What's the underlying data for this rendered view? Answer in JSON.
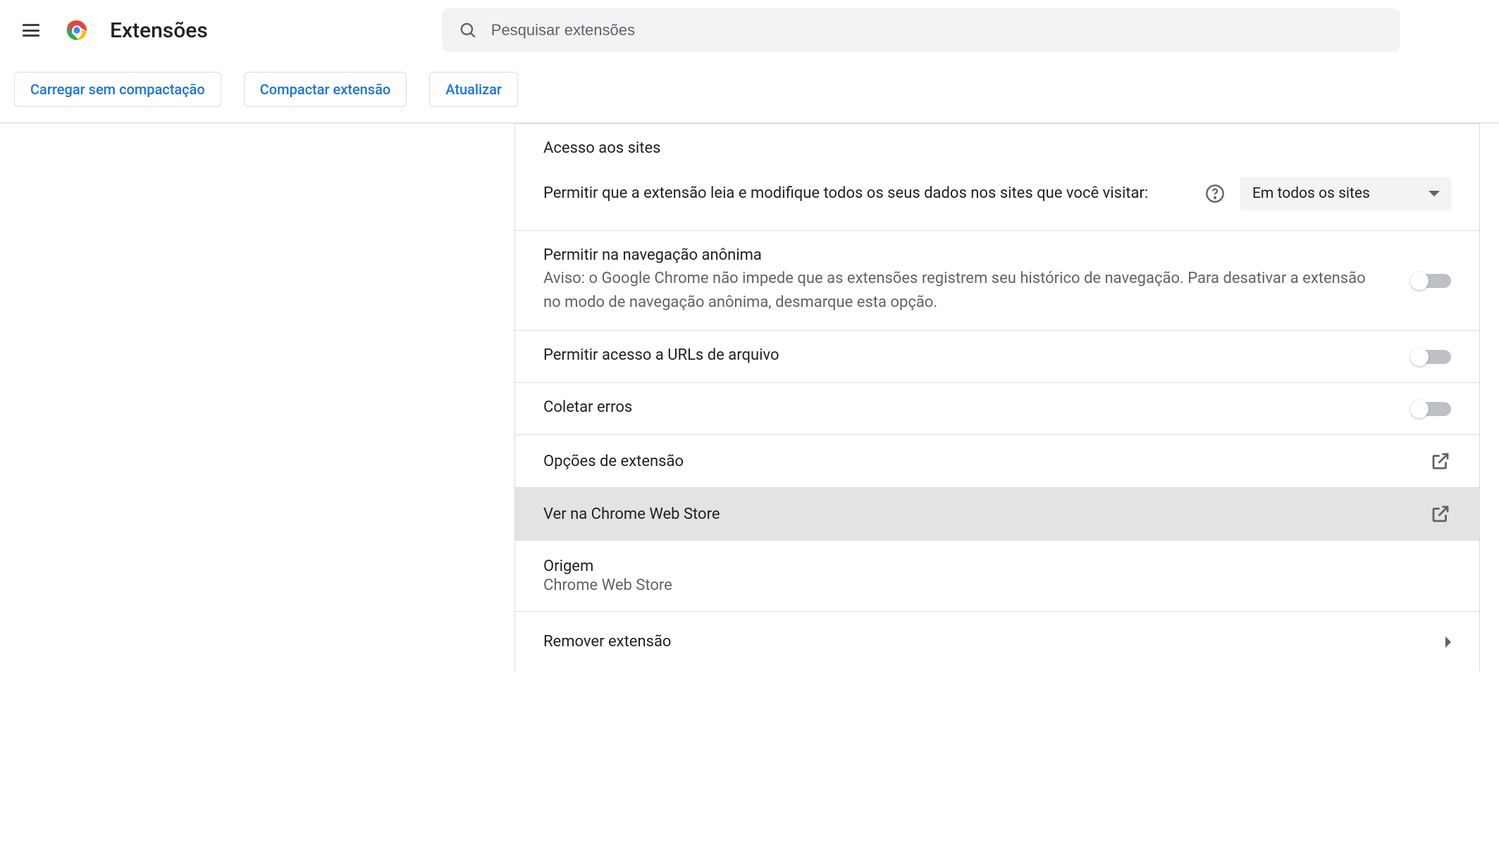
{
  "header": {
    "title": "Extensões",
    "search_placeholder": "Pesquisar extensões"
  },
  "toolbar": {
    "load_unpacked": "Carregar sem compactação",
    "pack_extension": "Compactar extensão",
    "update": "Atualizar"
  },
  "sections": {
    "site_access": {
      "heading": "Acesso aos sites",
      "description": "Permitir que a extensão leia e modifique todos os seus dados nos sites que você visitar:",
      "dropdown_selected": "Em todos os sites"
    },
    "incognito": {
      "title": "Permitir na navegação anônima",
      "warning": "Aviso: o Google Chrome não impede que as extensões registrem seu histórico de navegação. Para desativar a extensão no modo de navegação anônima, desmarque esta opção."
    },
    "file_urls": {
      "title": "Permitir acesso a URLs de arquivo"
    },
    "collect_errors": {
      "title": "Coletar erros"
    },
    "extension_options": {
      "label": "Opções de extensão"
    },
    "web_store": {
      "label": "Ver na Chrome Web Store"
    },
    "origin": {
      "title": "Origem",
      "value": "Chrome Web Store"
    },
    "remove": {
      "label": "Remover extensão"
    }
  }
}
